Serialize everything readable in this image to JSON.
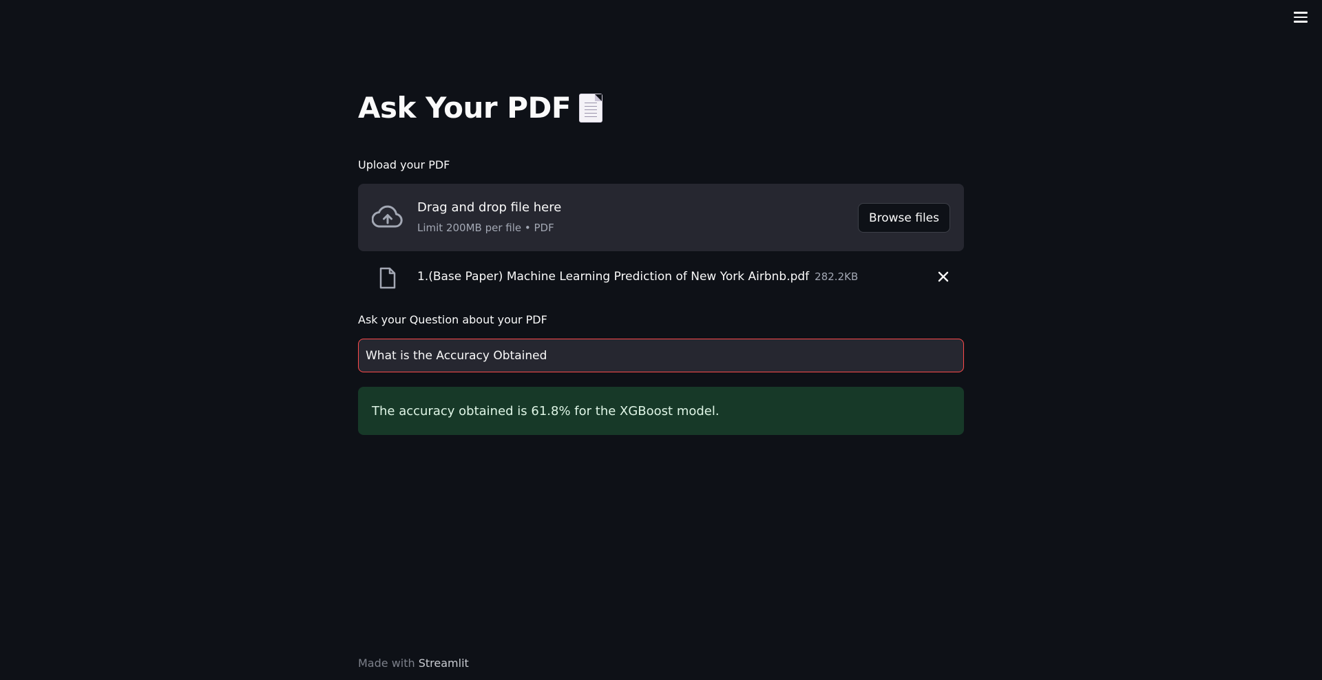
{
  "header": {
    "menu_icon": "hamburger-menu-icon"
  },
  "page": {
    "title": "Ask Your PDF",
    "title_icon": "page-facing-up-emoji"
  },
  "uploader": {
    "label": "Upload your PDF",
    "icon": "cloud-upload-icon",
    "drop_text": "Drag and drop file here",
    "limit_text": "Limit 200MB per file • PDF",
    "browse_label": "Browse files"
  },
  "uploaded_file": {
    "icon": "file-icon",
    "name": "1.(Base Paper) Machine Learning Prediction of New York Airbnb.pdf",
    "size": "282.2KB",
    "remove_icon": "close-icon"
  },
  "question": {
    "label": "Ask your Question about your PDF",
    "value": "What is the Accuracy Obtained"
  },
  "answer": {
    "text": "The accuracy obtained is 61.8% for the XGBoost model."
  },
  "footer": {
    "prefix": "Made with ",
    "brand": "Streamlit"
  },
  "colors": {
    "background": "#0e1117",
    "widget_bg": "#262730",
    "focus_border": "#ff4b4b",
    "success_bg": "#173928"
  }
}
